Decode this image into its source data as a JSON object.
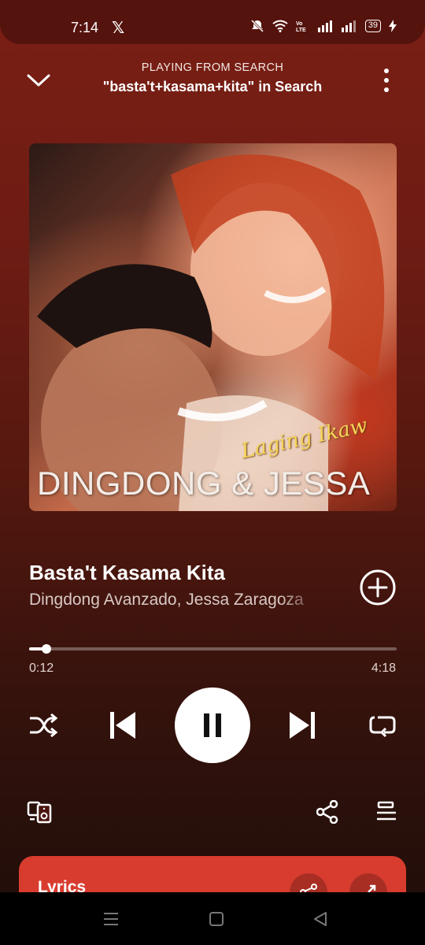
{
  "status": {
    "time": "7:14",
    "x_app": "𝕏",
    "battery": "39"
  },
  "header": {
    "subtitle": "PLAYING FROM SEARCH",
    "title": "\"basta't+kasama+kita\" in Search"
  },
  "album_art": {
    "script_title": "Laging Ikaw",
    "artist_text": "DINGDONG & JESSA"
  },
  "track": {
    "title": "Basta't Kasama Kita",
    "artists": "Dingdong Avanzado, Jessa Zaragoza"
  },
  "playback": {
    "current_time": "0:12",
    "total_time": "4:18",
    "progress_fraction": 0.047,
    "state": "playing"
  },
  "lyrics": {
    "label": "Lyrics"
  },
  "colors": {
    "background": "#6e1c14",
    "lyrics_card": "#d83c2f"
  },
  "icons": [
    "chevron-down-icon",
    "more-vert-icon",
    "add-circle-icon",
    "shuffle-icon",
    "previous-icon",
    "pause-icon",
    "next-icon",
    "repeat-icon",
    "connect-device-icon",
    "share-icon",
    "queue-icon"
  ]
}
